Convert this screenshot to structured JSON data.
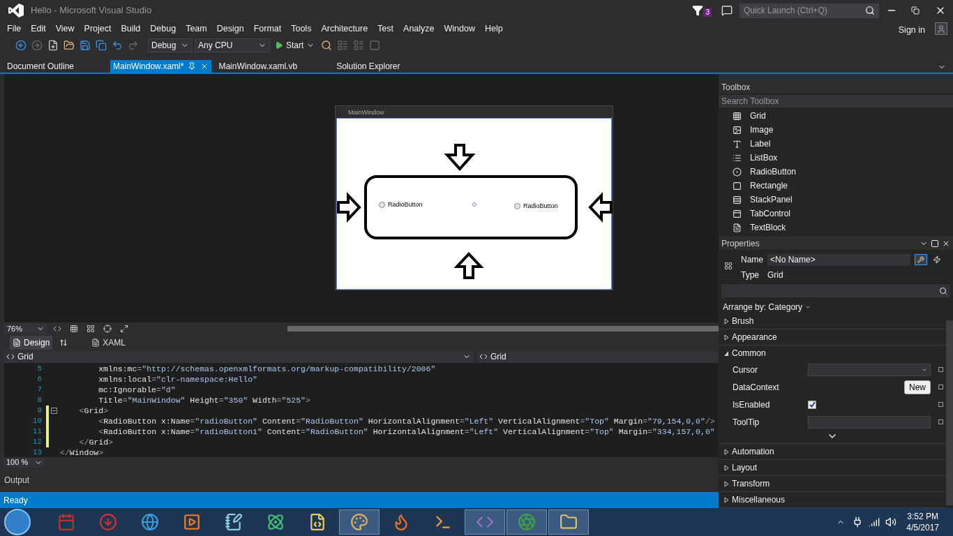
{
  "window": {
    "title": "Hello - Microsoft Visual Studio",
    "notification_count": "3",
    "quick_launch": {
      "placeholder": "Quick Launch (Ctrl+Q)"
    }
  },
  "menu": [
    "File",
    "Edit",
    "View",
    "Project",
    "Build",
    "Debug",
    "Team",
    "Design",
    "Format",
    "Tools",
    "Architecture",
    "Test",
    "Analyze",
    "Window",
    "Help"
  ],
  "account": {
    "sign_in": "Sign in"
  },
  "toolbar": {
    "configuration": "Debug",
    "platform": "Any CPU",
    "start": "Start"
  },
  "document_tabs": [
    {
      "label": "Document Outline",
      "selected": false
    },
    {
      "label": "MainWindow.xaml*",
      "selected": true
    },
    {
      "label": "MainWindow.xaml.vb",
      "selected": false
    },
    {
      "label": "Solution Explorer",
      "selected": false
    }
  ],
  "designer": {
    "window_title": "MainWindow",
    "radio_buttons": [
      {
        "label": "RadioButton",
        "checked": false
      },
      {
        "label": "RadioButton",
        "checked": false
      }
    ],
    "zoom": "76%",
    "view_tabs": [
      {
        "label": "Design",
        "selected": true
      },
      {
        "label": "XAML",
        "selected": false
      }
    ]
  },
  "breadcrumbs": [
    "Grid",
    "Grid"
  ],
  "code": {
    "zoom": "100 %",
    "lines": [
      {
        "number": "5",
        "modified": false,
        "foldable": false,
        "tokens": [
          {
            "kind": "attribute",
            "text": "        xmlns:mc"
          },
          {
            "kind": "punct",
            "text": "="
          },
          {
            "kind": "value",
            "text": "\"http://schemas.openxmlformats.org/markup-compatibility/2006\""
          }
        ]
      },
      {
        "number": "6",
        "modified": false,
        "foldable": false,
        "tokens": [
          {
            "kind": "attribute",
            "text": "        xmlns:local"
          },
          {
            "kind": "punct",
            "text": "="
          },
          {
            "kind": "value",
            "text": "\"clr-namespace:Hello\""
          }
        ]
      },
      {
        "number": "7",
        "modified": false,
        "foldable": false,
        "tokens": [
          {
            "kind": "attribute",
            "text": "        mc:Ignorable"
          },
          {
            "kind": "punct",
            "text": "="
          },
          {
            "kind": "value",
            "text": "\"d\""
          }
        ]
      },
      {
        "number": "8",
        "modified": false,
        "foldable": false,
        "tokens": [
          {
            "kind": "attribute",
            "text": "        Title"
          },
          {
            "kind": "punct",
            "text": "="
          },
          {
            "kind": "value",
            "text": "\"MainWindow\""
          },
          {
            "kind": "attribute",
            "text": " Height"
          },
          {
            "kind": "punct",
            "text": "="
          },
          {
            "kind": "value",
            "text": "\"350\""
          },
          {
            "kind": "attribute",
            "text": " Width"
          },
          {
            "kind": "punct",
            "text": "="
          },
          {
            "kind": "value",
            "text": "\"525\""
          },
          {
            "kind": "punct",
            "text": ">"
          }
        ]
      },
      {
        "number": "9",
        "modified": true,
        "foldable": true,
        "tokens": [
          {
            "kind": "punct",
            "text": "    <"
          },
          {
            "kind": "element",
            "text": "Grid"
          },
          {
            "kind": "punct",
            "text": ">"
          }
        ]
      },
      {
        "number": "10",
        "modified": true,
        "foldable": false,
        "tokens": [
          {
            "kind": "punct",
            "text": "        <"
          },
          {
            "kind": "element",
            "text": "RadioButton"
          },
          {
            "kind": "attribute",
            "text": " x:Name"
          },
          {
            "kind": "punct",
            "text": "="
          },
          {
            "kind": "value",
            "text": "\"radioButton\""
          },
          {
            "kind": "attribute",
            "text": " Content"
          },
          {
            "kind": "punct",
            "text": "="
          },
          {
            "kind": "value",
            "text": "\"RadioButton\""
          },
          {
            "kind": "attribute",
            "text": " HorizontalAlignment"
          },
          {
            "kind": "punct",
            "text": "="
          },
          {
            "kind": "value",
            "text": "\"Left\""
          },
          {
            "kind": "attribute",
            "text": " VerticalAlignment"
          },
          {
            "kind": "punct",
            "text": "="
          },
          {
            "kind": "value",
            "text": "\"Top\""
          },
          {
            "kind": "attribute",
            "text": " Margin"
          },
          {
            "kind": "punct",
            "text": "="
          },
          {
            "kind": "value",
            "text": "\"79,154,0,0\""
          },
          {
            "kind": "punct",
            "text": "/>"
          }
        ]
      },
      {
        "number": "11",
        "modified": true,
        "foldable": false,
        "tokens": [
          {
            "kind": "punct",
            "text": "        <"
          },
          {
            "kind": "element",
            "text": "RadioButton"
          },
          {
            "kind": "attribute",
            "text": " x:Name"
          },
          {
            "kind": "punct",
            "text": "="
          },
          {
            "kind": "value",
            "text": "\"radioButton1\""
          },
          {
            "kind": "attribute",
            "text": " Content"
          },
          {
            "kind": "punct",
            "text": "="
          },
          {
            "kind": "value",
            "text": "\"RadioButton\""
          },
          {
            "kind": "attribute",
            "text": " HorizontalAlignment"
          },
          {
            "kind": "punct",
            "text": "="
          },
          {
            "kind": "value",
            "text": "\"Left\""
          },
          {
            "kind": "attribute",
            "text": " VerticalAlignment"
          },
          {
            "kind": "punct",
            "text": "="
          },
          {
            "kind": "value",
            "text": "\"Top\""
          },
          {
            "kind": "attribute",
            "text": " Margin"
          },
          {
            "kind": "punct",
            "text": "="
          },
          {
            "kind": "value",
            "text": "\"334,157,0,0\""
          }
        ]
      },
      {
        "number": "12",
        "modified": true,
        "foldable": false,
        "tokens": [
          {
            "kind": "punct",
            "text": "    </"
          },
          {
            "kind": "element",
            "text": "Grid"
          },
          {
            "kind": "punct",
            "text": ">"
          }
        ]
      },
      {
        "number": "13",
        "modified": false,
        "foldable": false,
        "tokens": [
          {
            "kind": "punct",
            "text": "</"
          },
          {
            "kind": "element",
            "text": "Window"
          },
          {
            "kind": "punct",
            "text": ">"
          }
        ]
      }
    ]
  },
  "output": {
    "title": "Output"
  },
  "status_bar": {
    "text": "Ready"
  },
  "toolbox": {
    "title": "Toolbox",
    "search": {
      "placeholder": "Search Toolbox"
    },
    "items": [
      "Grid",
      "Image",
      "Label",
      "ListBox",
      "RadioButton",
      "Rectangle",
      "StackPanel",
      "TabControl",
      "TextBlock"
    ]
  },
  "properties": {
    "title": "Properties",
    "name_label": "Name",
    "name_value": "<No Name>",
    "type_label": "Type",
    "type_value": "Grid",
    "arrange_by": "Arrange by: Category",
    "categories": [
      {
        "label": "Brush",
        "expanded": false
      },
      {
        "label": "Appearance",
        "expanded": false
      },
      {
        "label": "Common",
        "expanded": true,
        "items": [
          {
            "kind": "dropdown",
            "label": "Cursor"
          },
          {
            "kind": "button",
            "label": "DataContext",
            "button": "New"
          },
          {
            "kind": "checkbox",
            "label": "IsEnabled",
            "checked": true
          },
          {
            "kind": "text",
            "label": "ToolTip"
          }
        ]
      },
      {
        "label": "Automation",
        "expanded": false
      },
      {
        "label": "Layout",
        "expanded": false
      },
      {
        "label": "Transform",
        "expanded": false
      },
      {
        "label": "Miscellaneous",
        "expanded": false
      }
    ]
  },
  "taskbar": {
    "time": "3:52 PM",
    "date": "4/5/2017"
  }
}
